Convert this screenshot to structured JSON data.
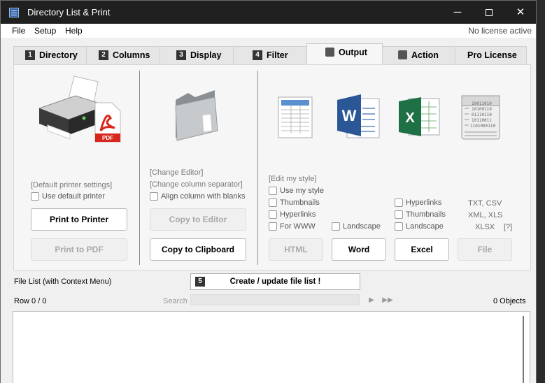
{
  "window": {
    "title": "Directory List & Print",
    "controls": {
      "minimize": "─",
      "close": "✕"
    }
  },
  "menu": {
    "items": [
      "File",
      "Setup",
      "Help"
    ],
    "license": "No license active"
  },
  "tabs": [
    {
      "num": "1",
      "label": "Directory"
    },
    {
      "num": "2",
      "label": "Columns"
    },
    {
      "num": "3",
      "label": "Display"
    },
    {
      "num": "4",
      "label": "Filter"
    },
    {
      "label": "Output",
      "active": true
    },
    {
      "label": "Action"
    },
    {
      "label": "Pro License"
    }
  ],
  "print_section": {
    "default_printer_settings": "[Default printer settings]",
    "use_default_printer": "Use default printer",
    "print_to_printer": "Print to Printer",
    "print_to_pdf": "Print to PDF"
  },
  "editor_section": {
    "change_editor": "[Change Editor]",
    "change_column_separator": "[Change column separator]",
    "align_column_with_blanks": "Align column with blanks",
    "copy_to_editor": "Copy to Editor",
    "copy_to_clipboard": "Copy to Clipboard"
  },
  "export_section": {
    "edit_my_style": "[Edit my style]",
    "use_my_style": "Use my style",
    "thumbnails": "Thumbnails",
    "hyperlinks": "Hyperlinks",
    "for_www": "For WWW",
    "landscape_word": "Landscape",
    "excel_hyperlinks": "Hyperlinks",
    "excel_thumbnails": "Thumbnails",
    "excel_landscape": "Landscape",
    "formats_1": "TXT, CSV",
    "formats_2": "XML, XLS",
    "formats_3": "XLSX",
    "help_hint": "[?]",
    "html_button": "HTML",
    "word_button": "Word",
    "excel_button": "Excel",
    "file_button": "File",
    "file_icon_bits": "10011010\n10100110\n01110110\n10110011\n1101000110",
    "word_icon_letter": "W",
    "excel_icon_letter": "X",
    "pdf_label": "PDF"
  },
  "file_list": {
    "label": "File List (with Context Menu)",
    "create_num": "5",
    "create_button": "Create / update file list !",
    "row": "Row 0 / 0",
    "search_label": "Search",
    "nav_next": "▶",
    "nav_last": "▶▶",
    "objects": "0 Objects"
  },
  "colors": {
    "titlebar_bg": "#202020",
    "panel_bg": "#f6f6f6",
    "word_blue": "#2b5797",
    "excel_green": "#1e7145",
    "pdf_red": "#d9261c"
  },
  "icons": {
    "app": "directory-list-icon",
    "printer": "printer-pdf-icon",
    "folder": "folder-icon",
    "html": "html-table-icon",
    "word": "word-icon",
    "excel": "excel-icon",
    "file": "text-file-icon"
  }
}
